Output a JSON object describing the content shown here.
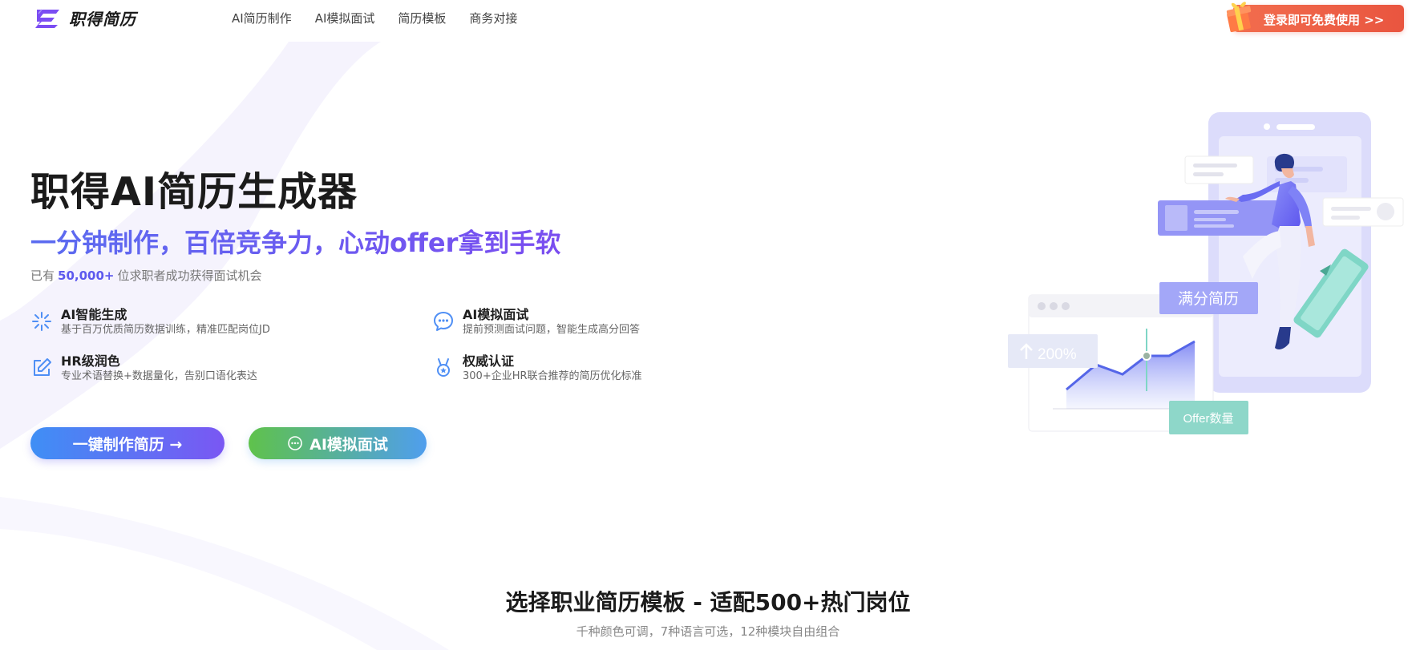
{
  "brand": {
    "name": "职得简历"
  },
  "nav": {
    "items": [
      "AI简历制作",
      "AI模拟面试",
      "简历模板",
      "商务对接"
    ]
  },
  "header_cta": {
    "label": "登录即可免费使用 >>"
  },
  "hero": {
    "title": "职得AI简历生成器",
    "subtitle": "一分钟制作，百倍竞争力，心动offer拿到手软",
    "stat_prefix": "已有",
    "stat_number": "50,000+",
    "stat_suffix": "位求职者成功获得面试机会"
  },
  "features": [
    {
      "title": "AI智能生成",
      "desc": "基于百万优质简历数据训练，精准匹配岗位JD",
      "icon": "sparkle-icon"
    },
    {
      "title": "AI模拟面试",
      "desc": "提前预测面试问题，智能生成高分回答",
      "icon": "chat-bubble-icon"
    },
    {
      "title": "HR级润色",
      "desc": "专业术语替换+数据量化，告别口语化表达",
      "icon": "edit-icon"
    },
    {
      "title": "权威认证",
      "desc": "300+企业HR联合推荐的简历优化标准",
      "icon": "medal-icon"
    }
  ],
  "buttons": {
    "primary": "一键制作简历 →",
    "secondary": "AI模拟面试"
  },
  "illustration": {
    "badge_score": "满分简历",
    "badge_growth": "200%",
    "badge_offer": "Offer数量"
  },
  "section": {
    "title": "选择职业简历模板 - 适配500+热门岗位",
    "subtitle": "千种颜色可调，7种语言可选，12种模块自由组合"
  },
  "colors": {
    "accent": "#6b5cf0",
    "cta": "#e9553f",
    "green": "#5fc24b",
    "blue": "#3f8ff5"
  }
}
